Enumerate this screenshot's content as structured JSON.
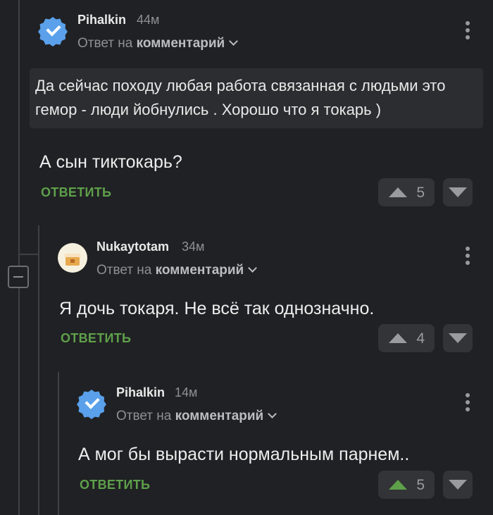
{
  "comments": [
    {
      "username": "Pihalkin",
      "time": "44м",
      "reply_prefix": "Ответ на",
      "reply_target": "комментарий",
      "quote": "Да сейчас походу любая работа связанная с людьми это гемор - люди йобнулись . Хорошо что я токарь )",
      "text": "А сын тиктокарь?",
      "reply_label": "ОТВЕТИТЬ",
      "votes": "5",
      "avatar": "verified-badge-icon"
    },
    {
      "username": "Nukaytotam",
      "time": "34м",
      "reply_prefix": "Ответ на",
      "reply_target": "комментарий",
      "text": "Я дочь токаря. Не всё так однозначно.",
      "reply_label": "ОТВЕТИТЬ",
      "votes": "4",
      "avatar": "cake-avatar"
    },
    {
      "username": "Pihalkin",
      "time": "14м",
      "reply_prefix": "Ответ на",
      "reply_target": "комментарий",
      "text": "А мог бы вырасти нормальным парнем..",
      "reply_label": "ОТВЕТИТЬ",
      "votes": "5",
      "avatar": "verified-badge-icon",
      "upvoted": true
    }
  ],
  "colors": {
    "background": "#202124",
    "accent_green": "#5ea04a",
    "verified_blue": "#5aa0ea"
  }
}
